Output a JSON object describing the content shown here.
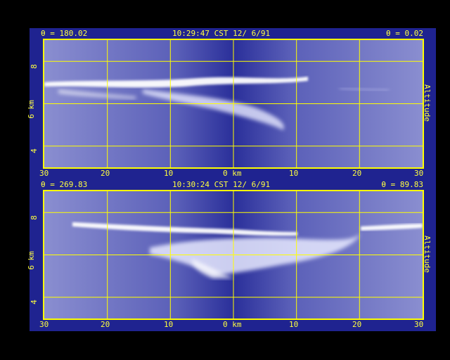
{
  "colors": {
    "frame": "#ffff00",
    "text": "#ffff40",
    "background": "#1f2390",
    "cloud": "#ffffff"
  },
  "chart_data": [
    {
      "type": "heatmap",
      "header_left": "θ = 180.02",
      "header_center": "10:29:47 CST 12/ 6/91",
      "header_right": "θ = 0.02",
      "xticks": [
        "30",
        "20",
        "10",
        "0 km",
        "10",
        "20",
        "30"
      ],
      "yticks": [
        "8",
        "6 km",
        "4"
      ],
      "ylabel_right": "Altitude",
      "xlim": [
        -30,
        30
      ],
      "ylim": [
        3,
        9
      ]
    },
    {
      "type": "heatmap",
      "header_left": "θ = 269.83",
      "header_center": "10:30:24 CST 12/ 6/91",
      "header_right": "θ = 89.83",
      "xticks": [
        "30",
        "20",
        "10",
        "0 km",
        "10",
        "20",
        "30"
      ],
      "yticks": [
        "8",
        "6 km",
        "4"
      ],
      "ylabel_right": "Altitude",
      "xlim": [
        -30,
        30
      ],
      "ylim": [
        3,
        9
      ]
    }
  ]
}
